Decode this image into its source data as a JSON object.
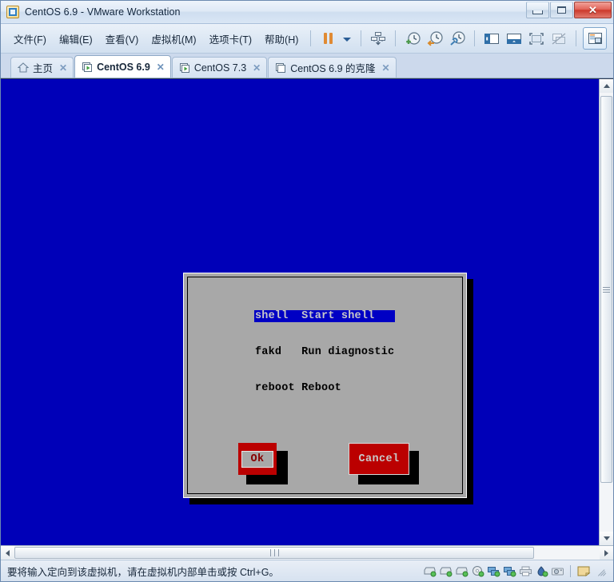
{
  "window": {
    "title": "CentOS 6.9 - VMware Workstation",
    "app_icon": "vmware-icon",
    "buttons": {
      "minimize": "minimize-button",
      "maximize": "restore-button",
      "close": "close-button",
      "close_glyph": "✕"
    },
    "accent_blue": "#0000b8",
    "close_red": "#cc3a2c"
  },
  "menu": {
    "items": [
      {
        "label": "文件(F)",
        "name": "menu-file"
      },
      {
        "label": "编辑(E)",
        "name": "menu-edit"
      },
      {
        "label": "查看(V)",
        "name": "menu-view"
      },
      {
        "label": "虚拟机(M)",
        "name": "menu-vm"
      },
      {
        "label": "选项卡(T)",
        "name": "menu-tabs"
      },
      {
        "label": "帮助(H)",
        "name": "menu-help"
      }
    ]
  },
  "toolbar": {
    "buttons": [
      {
        "name": "suspend-button",
        "icon": "pause-icon",
        "tooltip": "挂起"
      },
      {
        "name": "power-dropdown-button",
        "icon": "chevron-down-icon",
        "tooltip": "电源菜单"
      },
      {
        "name": "send-ctrl-alt-del-button",
        "icon": "send-keys-icon",
        "tooltip": "发送 Ctrl+Alt+Del"
      },
      {
        "name": "take-snapshot-button",
        "icon": "snapshot-add-clock-icon",
        "tooltip": "拍摄快照"
      },
      {
        "name": "revert-snapshot-button",
        "icon": "snapshot-revert-clock-icon",
        "tooltip": "恢复快照"
      },
      {
        "name": "manage-snapshots-button",
        "icon": "snapshot-manage-clock-icon",
        "tooltip": "快照管理器"
      },
      {
        "name": "show-library-button",
        "icon": "sidebar-panel-icon",
        "tooltip": "显示或隐藏库"
      },
      {
        "name": "show-thumbnail-bar-button",
        "icon": "thumbnail-bar-icon",
        "tooltip": "显示缩略图栏"
      },
      {
        "name": "enter-fullscreen-button",
        "icon": "fullscreen-icon",
        "tooltip": "进入全屏"
      },
      {
        "name": "unity-mode-button",
        "icon": "unity-mode-icon",
        "tooltip": "Unity 模式",
        "disabled": true
      },
      {
        "name": "console-view-button",
        "icon": "console-view-icon",
        "tooltip": "控制台视图",
        "selected": true
      }
    ]
  },
  "tabs": [
    {
      "label": "主页",
      "icon": "home-icon",
      "active": false,
      "closable": true,
      "name": "tab-home"
    },
    {
      "label": "CentOS 6.9",
      "icon": "vm-running-icon",
      "active": true,
      "closable": true,
      "name": "tab-centos-69"
    },
    {
      "label": "CentOS 7.3",
      "icon": "vm-running-icon",
      "active": false,
      "closable": true,
      "name": "tab-centos-73"
    },
    {
      "label": "CentOS 6.9 的克隆",
      "icon": "vm-clone-icon",
      "active": false,
      "closable": true,
      "name": "tab-centos-69-clone"
    }
  ],
  "tab_close_glyph": "✕",
  "console": {
    "background_color": "#0000b8",
    "dialog": {
      "background_color": "#a8a8a8",
      "highlight_color": "#0000c4",
      "menu_items": [
        {
          "key": "shell ",
          "description": "Start shell",
          "selected": true
        },
        {
          "key": "fakd  ",
          "description": "Run diagnostic",
          "selected": false
        },
        {
          "key": "reboot",
          "description": "Reboot",
          "selected": false
        }
      ],
      "buttons": [
        {
          "label": "Ok",
          "focused": true,
          "name": "dialog-ok-button"
        },
        {
          "label": "Cancel",
          "focused": false,
          "name": "dialog-cancel-button"
        }
      ],
      "button_color": "#bb0000"
    }
  },
  "statusbar": {
    "message": "要将输入定向到该虚拟机，请在虚拟机内部单击或按 Ctrl+G。",
    "devices": [
      {
        "name": "status-hard-disk-1",
        "icon": "hard-disk-icon"
      },
      {
        "name": "status-hard-disk-2",
        "icon": "hard-disk-icon"
      },
      {
        "name": "status-hard-disk-3",
        "icon": "hard-disk-icon"
      },
      {
        "name": "status-cd-dvd",
        "icon": "cd-dvd-icon"
      },
      {
        "name": "status-network-adapter-1",
        "icon": "network-adapter-icon"
      },
      {
        "name": "status-network-adapter-2",
        "icon": "network-adapter-icon"
      },
      {
        "name": "status-printer",
        "icon": "printer-icon"
      },
      {
        "name": "status-usb",
        "icon": "usb-icon"
      },
      {
        "name": "status-camera",
        "icon": "camera-icon"
      },
      {
        "name": "status-notes",
        "icon": "sticky-note-icon"
      }
    ]
  },
  "scrollbars": {
    "vertical": {
      "name": "vertical-scrollbar",
      "up": "scroll-up-arrow",
      "down": "scroll-down-arrow"
    },
    "horizontal": {
      "name": "horizontal-scrollbar",
      "left": "scroll-left-arrow",
      "right": "scroll-right-arrow"
    }
  }
}
